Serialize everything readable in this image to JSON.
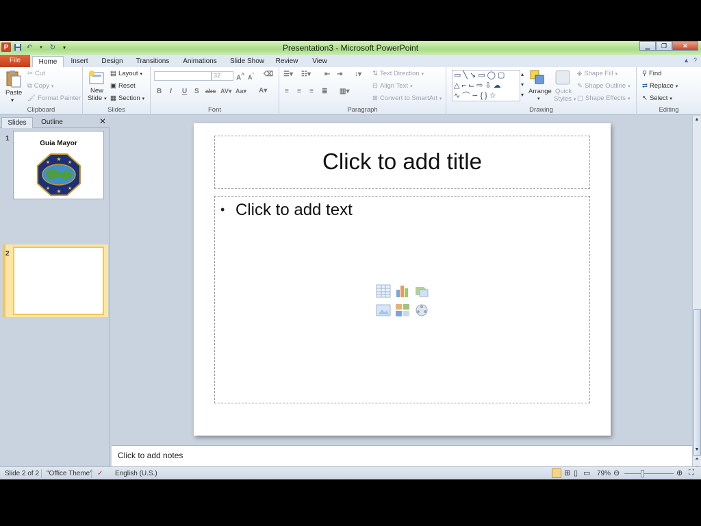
{
  "window": {
    "title": "Presentation3 - Microsoft PowerPoint",
    "minimize": "▁",
    "restore": "❐",
    "close": "✕"
  },
  "tabs": [
    "File",
    "Home",
    "Insert",
    "Design",
    "Transitions",
    "Animations",
    "Slide Show",
    "Review",
    "View"
  ],
  "active_tab": "Home",
  "ribbon": {
    "clipboard": {
      "paste": "Paste",
      "cut": "Cut",
      "copy": "Copy",
      "format_painter": "Format Painter",
      "label": "Clipboard"
    },
    "slides": {
      "new_slide_1": "New",
      "new_slide_2": "Slide",
      "layout": "Layout",
      "reset": "Reset",
      "section": "Section",
      "label": "Slides"
    },
    "font": {
      "font_name": "",
      "font_size": "32",
      "label": "Font"
    },
    "paragraph": {
      "text_direction": "Text Direction",
      "align_text": "Align Text",
      "convert_smartart": "Convert to SmartArt",
      "label": "Paragraph"
    },
    "drawing": {
      "arrange": "Arrange",
      "quick_styles_1": "Quick",
      "quick_styles_2": "Styles",
      "shape_fill": "Shape Fill",
      "shape_outline": "Shape Outline",
      "shape_effects": "Shape Effects",
      "label": "Drawing"
    },
    "editing": {
      "find": "Find",
      "replace": "Replace",
      "select": "Select",
      "label": "Editing"
    }
  },
  "left_pane": {
    "tabs": [
      "Slides",
      "Outline"
    ],
    "active_tab": "Slides",
    "slides": [
      {
        "number": "1",
        "title": "Guía Mayor"
      },
      {
        "number": "2",
        "title": ""
      }
    ],
    "selected_slide": 2
  },
  "slide": {
    "title_placeholder": "Click to add title",
    "body_placeholder": "Click to add text",
    "bullet": "•"
  },
  "notes_placeholder": "Click to add notes",
  "status": {
    "slide_info": "Slide 2 of 2",
    "theme": "\"Office Theme\"",
    "language": "English (U.S.)",
    "zoom": "79%"
  }
}
